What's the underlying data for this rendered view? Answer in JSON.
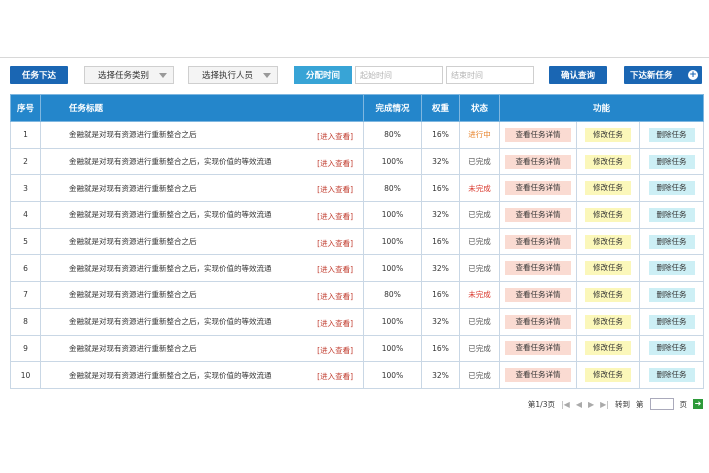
{
  "toolbar": {
    "issue_task_label": "任务下达",
    "task_type_select": "选择任务类别",
    "executor_select": "选择执行人员",
    "assign_time_label": "分配时间",
    "start_time_placeholder": "起始时间",
    "end_time_placeholder": "结束时间",
    "confirm_query_label": "确认查询",
    "issue_new_task_label": "下达新任务"
  },
  "table": {
    "headers": {
      "index": "序号",
      "title": "任务标题",
      "completion": "完成情况",
      "weight": "权重",
      "status": "状态",
      "actions": "功能"
    },
    "view_link": "[进入查看]",
    "action_labels": {
      "detail": "查看任务详情",
      "edit": "修改任务",
      "delete": "删除任务"
    },
    "rows": [
      {
        "index": "1",
        "title": "金融就是对现有资源进行重新整合之后",
        "completion": "80%",
        "weight": "16%",
        "status": "进行中",
        "status_type": "run"
      },
      {
        "index": "2",
        "title": "金融就是对现有资源进行重新整合之后，实现价值的等效流通",
        "completion": "100%",
        "weight": "32%",
        "status": "已完成",
        "status_type": "done"
      },
      {
        "index": "3",
        "title": "金融就是对现有资源进行重新整合之后",
        "completion": "80%",
        "weight": "16%",
        "status": "未完成",
        "status_type": "undone"
      },
      {
        "index": "4",
        "title": "金融就是对现有资源进行重新整合之后，实现价值的等效流通",
        "completion": "100%",
        "weight": "32%",
        "status": "已完成",
        "status_type": "done"
      },
      {
        "index": "5",
        "title": "金融就是对现有资源进行重新整合之后",
        "completion": "100%",
        "weight": "16%",
        "status": "已完成",
        "status_type": "done"
      },
      {
        "index": "6",
        "title": "金融就是对现有资源进行重新整合之后，实现价值的等效流通",
        "completion": "100%",
        "weight": "32%",
        "status": "已完成",
        "status_type": "done"
      },
      {
        "index": "7",
        "title": "金融就是对现有资源进行重新整合之后",
        "completion": "80%",
        "weight": "16%",
        "status": "未完成",
        "status_type": "undone"
      },
      {
        "index": "8",
        "title": "金融就是对现有资源进行重新整合之后，实现价值的等效流通",
        "completion": "100%",
        "weight": "32%",
        "status": "已完成",
        "status_type": "done"
      },
      {
        "index": "9",
        "title": "金融就是对现有资源进行重新整合之后",
        "completion": "100%",
        "weight": "16%",
        "status": "已完成",
        "status_type": "done"
      },
      {
        "index": "10",
        "title": "金融就是对现有资源进行重新整合之后，实现价值的等效流通",
        "completion": "100%",
        "weight": "32%",
        "status": "已完成",
        "status_type": "done"
      }
    ]
  },
  "pager": {
    "page_info": "第1/3页",
    "goto_label": "转到",
    "page_prefix": "第",
    "page_suffix": "页"
  },
  "colors": {
    "primary": "#1a66b3",
    "header": "#2486cb",
    "time_button": "#38a4d6",
    "status_running": "#e67e22",
    "status_undone": "#d9352a"
  },
  "icons": {
    "caret": "chevron-down-icon",
    "plus": "plus-circle-icon",
    "first": "first-page-icon",
    "prev": "prev-page-icon",
    "next": "next-page-icon",
    "last": "last-page-icon",
    "go": "go-arrow-icon"
  }
}
